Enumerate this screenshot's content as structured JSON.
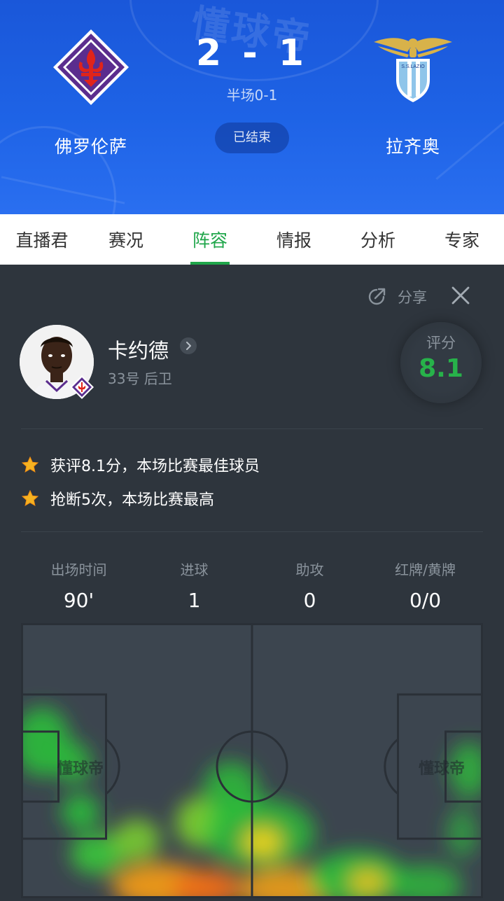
{
  "match": {
    "home_team": "佛罗伦萨",
    "away_team": "拉齐奥",
    "away_badge_text": "S.S.LAZIO",
    "score": "2 - 1",
    "halftime": "半场0-1",
    "status": "已结束",
    "watermark": "懂球帝"
  },
  "tabs": [
    {
      "label": "直播君"
    },
    {
      "label": "赛况"
    },
    {
      "label": "阵容",
      "active": true
    },
    {
      "label": "情报"
    },
    {
      "label": "分析"
    },
    {
      "label": "专家"
    }
  ],
  "panel": {
    "share_label": "分享",
    "player": {
      "name": "卡约德",
      "meta": "33号 后卫",
      "rating_label": "评分",
      "rating_value": "8.1"
    },
    "highlights": [
      {
        "icon": "star-icon",
        "text": "获评8.1分，本场比赛最佳球员"
      },
      {
        "icon": "star-icon",
        "text": "抢断5次，本场比赛最高"
      }
    ],
    "stats": [
      {
        "label": "出场时间",
        "value": "90'"
      },
      {
        "label": "进球",
        "value": "1"
      },
      {
        "label": "助攻",
        "value": "0"
      },
      {
        "label": "红牌/黄牌",
        "value": "0/0"
      }
    ],
    "pitch_watermark_left": "懂球帝",
    "pitch_watermark_right": "懂球帝"
  },
  "colors": {
    "header_blue": "#1e63e6",
    "accent_green": "#1fa64a",
    "rating_green": "#27b24a",
    "panel_bg": "#2e353d",
    "star_gold": "#f5b321"
  }
}
